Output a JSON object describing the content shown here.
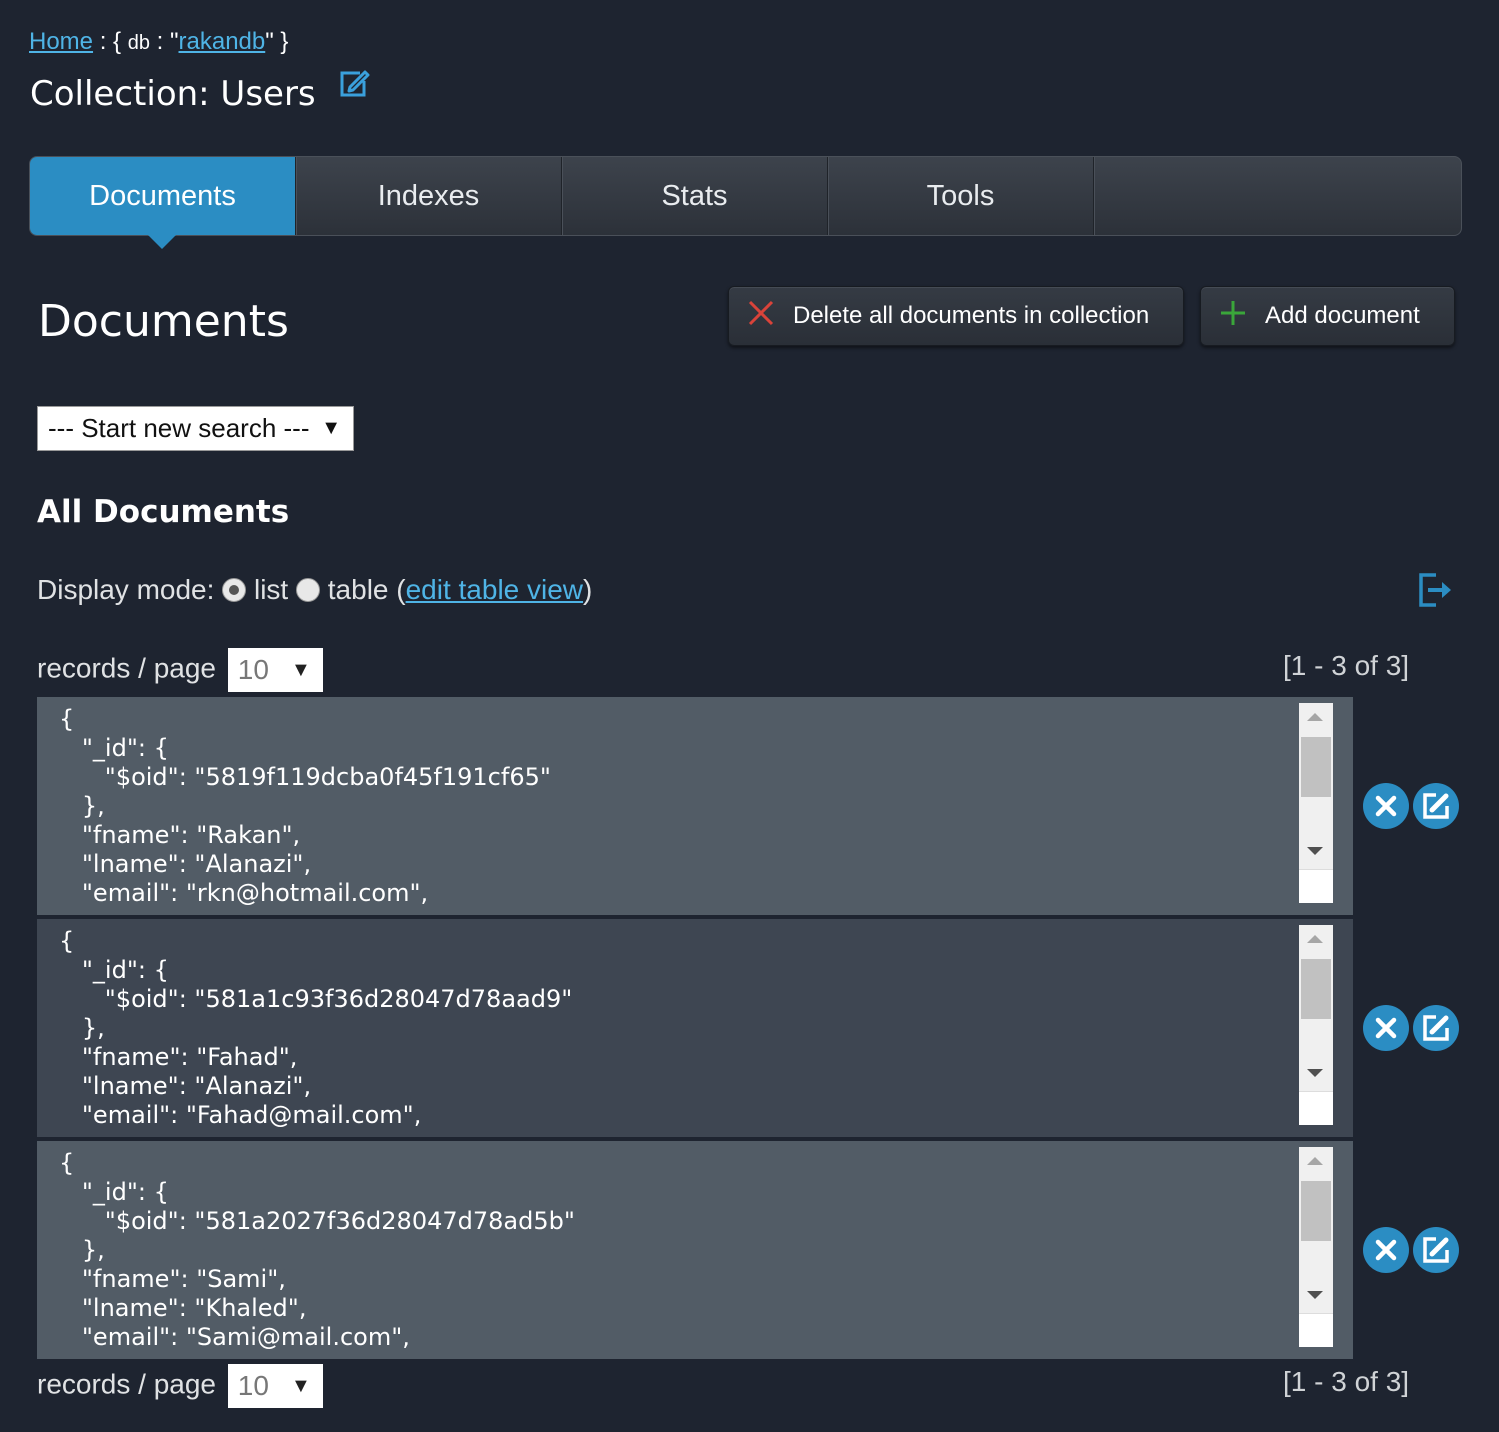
{
  "breadcrumb": {
    "home": "Home",
    "sep1": " : { ",
    "db_key": "db",
    "sep2": " : \"",
    "db_name": "rakandb",
    "sep3": "\" }"
  },
  "collection": {
    "label": "Collection: Users"
  },
  "tabs": [
    "Documents",
    "Indexes",
    "Stats",
    "Tools"
  ],
  "page": {
    "heading": "Documents"
  },
  "actions": {
    "delete_all": "Delete all documents in collection",
    "add_document": "Add document"
  },
  "search": {
    "selected": "--- Start new search ---"
  },
  "all_documents": {
    "heading": "All Documents"
  },
  "display_mode": {
    "label": "Display mode:",
    "list": "list",
    "table": "table",
    "open_paren": "(",
    "edit_link": "edit table view",
    "close_paren": ")",
    "selected": "list"
  },
  "pagination": {
    "records_label": "records / page",
    "per_page": "10",
    "range": "[1 - 3 of 3]"
  },
  "documents": [
    {
      "text": "{\n   \"_id\": {\n      \"$oid\": \"5819f119dcba0f45f191cf65\"\n   },\n   \"fname\": \"Rakan\",\n   \"lname\": \"Alanazi\",\n   \"email\": \"rkn@hotmail.com\","
    },
    {
      "text": "{\n   \"_id\": {\n      \"$oid\": \"581a1c93f36d28047d78aad9\"\n   },\n   \"fname\": \"Fahad\",\n   \"lname\": \"Alanazi\",\n   \"email\": \"Fahad@mail.com\","
    },
    {
      "text": "{\n   \"_id\": {\n      \"$oid\": \"581a2027f36d28047d78ad5b\"\n   },\n   \"fname\": \"Sami\",\n   \"lname\": \"Khaled\",\n   \"email\": \"Sami@mail.com\","
    }
  ],
  "colors": {
    "background": "#1e2430",
    "accent": "#2b8dc3",
    "link": "#4fb4e6",
    "doc_bg_primary": "#525c66",
    "doc_bg_secondary": "#3e4652",
    "delete_red": "#d9433a",
    "add_green": "#3aa63a"
  }
}
